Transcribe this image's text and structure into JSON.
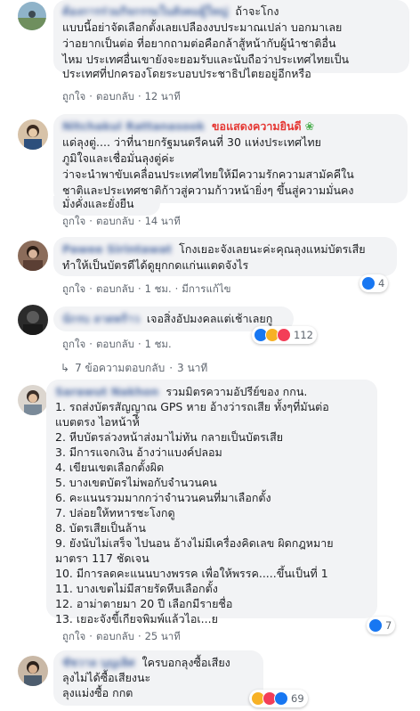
{
  "comments": [
    {
      "author": "ต้องการร่วมกิจกรรมในสังคมผู้ใหญ่",
      "lines": [
        "แบบนี้อย่าจัดเลือกตั้งเลยเปลืองงบประมาณเปล่า บอกมาเลย",
        "ว่าอยากเป็นต่อ ที่อยากถามต่อคือกล้าสู้หน้ากับผู้นำชาติอื่น",
        "ไหม ประเทศอื่นเขายังจะยอมรับและนับถือว่าประเทศไทยเป็น",
        "ประเทศที่ปกครองโดยระบอบประชาธิปไตยอยู่อีกหรือ"
      ],
      "first_line_tail": "ถ้าจะโกง",
      "like": "ถูกใจ",
      "reply": "ตอบกลับ",
      "time": "12 นาที"
    },
    {
      "author": "Nitchakul Rattanasook",
      "highlight": "ขอแสดงความยินดี",
      "flower": "❀",
      "lines": [
        "แด่ลุงตู่.... ว่าที่นายกรัฐมนตรีคนที่ 30 แห่งประเทศไทย",
        "ภูมิใจและเชื่อมั่นลุงตู่ค่ะ",
        "ว่าจะนำพาขับเคลื่อนประเทศไทยให้มีความรักความสามัคคีใน",
        "ชาติและประเทศชาติก้าวสู่ความก้าวหน้ายิ่งๆ ขึ้นสู่ความมั่นคง",
        "มั่งคั่งและยั่งยืน"
      ],
      "like": "ถูกใจ",
      "reply": "ตอบกลับ",
      "time": "14 นาที"
    },
    {
      "author": "Pawee Sirintawat",
      "lines": [
        "โกงเยอะจังเลยนะค่ะคุณลุงแหม่บัตรเสีย",
        "ทำให้เป็นบัตรดีได้ดูยุกกดแก่นแตดจังไร"
      ],
      "like": "ถูกใจ",
      "reply": "ตอบกลับ",
      "time": "1 ชม.",
      "edited": "มีการแก้ไข",
      "reaction_count": "4"
    },
    {
      "author": "นักรบ ลาดพร้าว",
      "lines": [
        "เจอสิ่งอัปมงคลแต่เช้าเลยกู"
      ],
      "like": "ถูกใจ",
      "reply": "ตอบกลับ",
      "time": "1 ชม.",
      "reaction_count": "112",
      "replies_label": "7 ข้อความตอบกลับ",
      "replies_time": "3 นาที"
    },
    {
      "author": "Sarawut Nakhon",
      "lines": [
        "1. รถส่งบัตรสัญญาณ GPS หาย อ้างว่ารถเสีย ทั้งๆที่มันต่อ",
        "แบตตรง ไอหน้าห้ี",
        "2. หีบบัตรล่วงหน้าส่งมาไม่ทัน กลายเป็นบัตรเสีย",
        "3. มีการแจกเงิน อ้างว่าแบงค์ปลอม",
        "4. เขียนเขตเลือกตั้งผิด",
        "5. บางเขตบัตรไม่พอกับจำนวนคน",
        "6. คะแนนรวมมากกว่าจำนวนคนที่มาเลือกตั้ง",
        "7. ปล่อยให้ทหารชะโงกดู",
        "8. บัตรเสียเป็นล้าน",
        "9. ยังนับไม่เสร็จ ไปนอน อ้างไม่มีเครื่องคิดเลข ผิดกฎหมาย",
        "มาตรา 117 ชัดเจน",
        "10. มีการลดคะแนนบางพรรค เพื่อให้พรรค.....ขึ้นเป็นที่ 1",
        "11. บางเขตไม่มีสายรัดหีบเลือกตั้ง",
        "12. อาม่าตายมา 20 ปี เลือกมีรายชื่อ",
        "13. เยอะจังขี้เกียจพิมพ์แล้วไอเ...ย"
      ],
      "first_line_tail": "รวมมิตรความอัปรีย์ของ กกน.",
      "like": "ถูกใจ",
      "reply": "ตอบกลับ",
      "time": "25 นาที",
      "reaction_count": "7"
    },
    {
      "author": "ชัชวาล บุญเลิศ",
      "lines": [
        "ลุงไม่ได้ซื้อเสียงนะ",
        "ลุงแม่งซื้อ กกต"
      ],
      "first_line_tail": "ใครบอกลุงซื้อเสียง",
      "reaction_count": "69"
    }
  ],
  "colors": {
    "link": "#385898",
    "meta": "#606770",
    "bubble": "#f2f3f5",
    "like": "#1877f2",
    "haha": "#f7b125",
    "love": "#f33e58",
    "highlight": "#e53935"
  }
}
